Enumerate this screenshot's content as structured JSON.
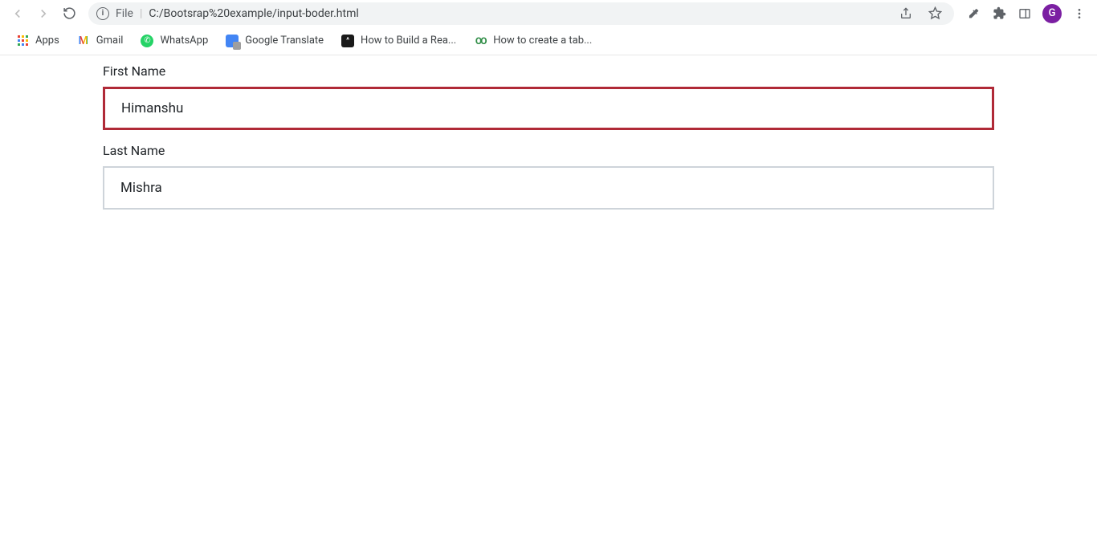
{
  "browser": {
    "url_prefix": "File",
    "url": "C:/Bootsrap%20example/input-boder.html",
    "profile_initial": "G"
  },
  "bookmarks": {
    "apps": "Apps",
    "gmail": "Gmail",
    "whatsapp": "WhatsApp",
    "translate": "Google Translate",
    "howbuild": "How to Build a Rea...",
    "howcreate": "How to create a tab..."
  },
  "form": {
    "first_name_label": "First Name",
    "first_name_value": "Himanshu",
    "last_name_label": "Last Name",
    "last_name_value": "Mishra"
  }
}
